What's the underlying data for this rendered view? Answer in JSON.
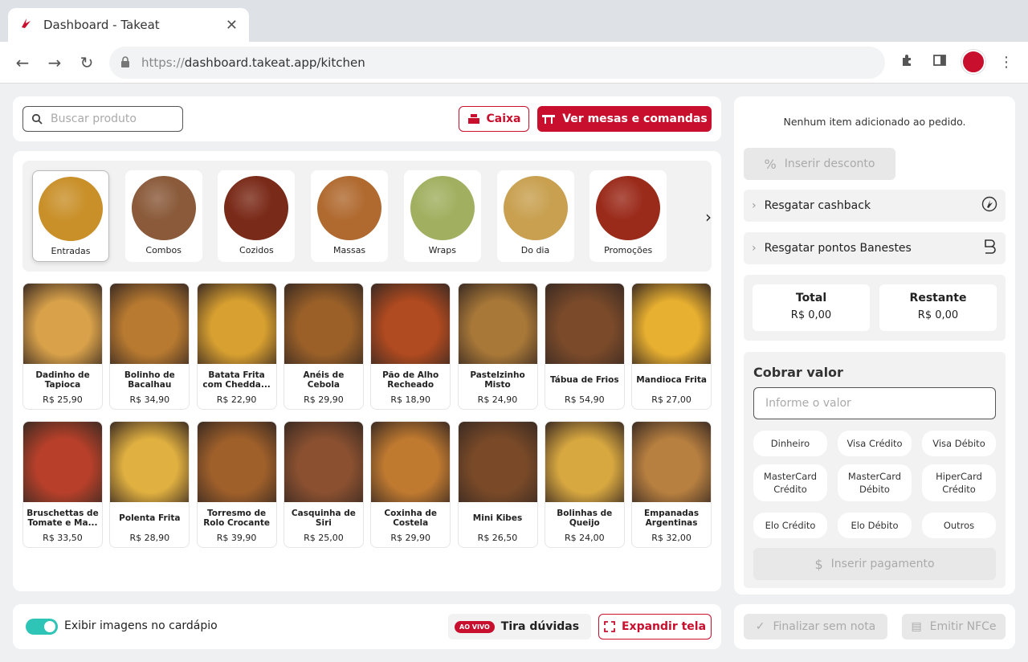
{
  "browser": {
    "tab_title": "Dashboard - Takeat",
    "url_scheme": "https://",
    "url_rest": "dashboard.takeat.app/kitchen"
  },
  "header": {
    "search_placeholder": "Buscar produto",
    "caixa_label": "Caixa",
    "tables_label": "Ver mesas e comandas"
  },
  "categories": [
    {
      "label": "Entradas",
      "active": true,
      "color": "#c9902a"
    },
    {
      "label": "Combos",
      "active": false,
      "color": "#8a5a3a"
    },
    {
      "label": "Cozidos",
      "active": false,
      "color": "#7a2a18"
    },
    {
      "label": "Massas",
      "active": false,
      "color": "#b06a30"
    },
    {
      "label": "Wraps",
      "active": false,
      "color": "#a0b060"
    },
    {
      "label": "Do dia",
      "active": false,
      "color": "#c8a050"
    },
    {
      "label": "Promoções",
      "active": false,
      "color": "#9a2a1a"
    }
  ],
  "products": [
    {
      "name": "Dadinho de Tapioca",
      "price": "R$ 25,90",
      "color": "#d9a24a"
    },
    {
      "name": "Bolinho de Bacalhau",
      "price": "R$ 34,90",
      "color": "#b87a30"
    },
    {
      "name": "Batata Frita com Chedda...",
      "price": "R$ 22,90",
      "color": "#d8a030"
    },
    {
      "name": "Anéis de Cebola",
      "price": "R$ 29,90",
      "color": "#9a6028"
    },
    {
      "name": "Pão de Alho Recheado",
      "price": "R$ 18,90",
      "color": "#b04a20"
    },
    {
      "name": "Pastelzinho Misto",
      "price": "R$ 24,90",
      "color": "#a87838"
    },
    {
      "name": "Tábua de Frios",
      "price": "R$ 54,90",
      "color": "#7a4a2a"
    },
    {
      "name": "Mandioca Frita",
      "price": "R$ 27,00",
      "color": "#e8b030"
    },
    {
      "name": "Bruschettas de Tomate e Ma...",
      "price": "R$ 33,50",
      "color": "#b8402a"
    },
    {
      "name": "Polenta Frita",
      "price": "R$ 28,90",
      "color": "#e0b040"
    },
    {
      "name": "Torresmo de Rolo Crocante",
      "price": "R$ 39,90",
      "color": "#a0602a"
    },
    {
      "name": "Casquinha de Siri",
      "price": "R$ 25,00",
      "color": "#8a5030"
    },
    {
      "name": "Coxinha de Costela",
      "price": "R$ 29,90",
      "color": "#c07a30"
    },
    {
      "name": "Mini Kibes",
      "price": "R$ 26,50",
      "color": "#7a4a28"
    },
    {
      "name": "Bolinhas de Queijo",
      "price": "R$ 24,00",
      "color": "#d8a840"
    },
    {
      "name": "Empanadas Argentinas",
      "price": "R$ 32,00",
      "color": "#b88040"
    }
  ],
  "order": {
    "empty_message": "Nenhum item adicionado ao pedido.",
    "discount_label": "Inserir desconto",
    "cashback_label": "Resgatar cashback",
    "points_label": "Resgatar pontos Banestes",
    "total_title": "Total",
    "total_value": "R$ 0,00",
    "remaining_title": "Restante",
    "remaining_value": "R$ 0,00",
    "charge_title": "Cobrar valor",
    "charge_placeholder": "Informe o valor",
    "payment_methods": [
      "Dinheiro",
      "Visa Crédito",
      "Visa Débito",
      "MasterCard Crédito",
      "MasterCard Débito",
      "HiperCard Crédito",
      "Elo Crédito",
      "Elo Débito",
      "Outros"
    ],
    "insert_payment_label": "Inserir pagamento",
    "finalize_label": "Finalizar sem nota",
    "nfce_label": "Emitir NFCe"
  },
  "footer": {
    "toggle_label": "Exibir imagens no cardápio",
    "live_badge": "AO VIVO",
    "help_label": "Tira dúvidas",
    "expand_label": "Expandir tela"
  },
  "colors": {
    "brand": "#c8102e",
    "toggle": "#2ec4b6"
  }
}
